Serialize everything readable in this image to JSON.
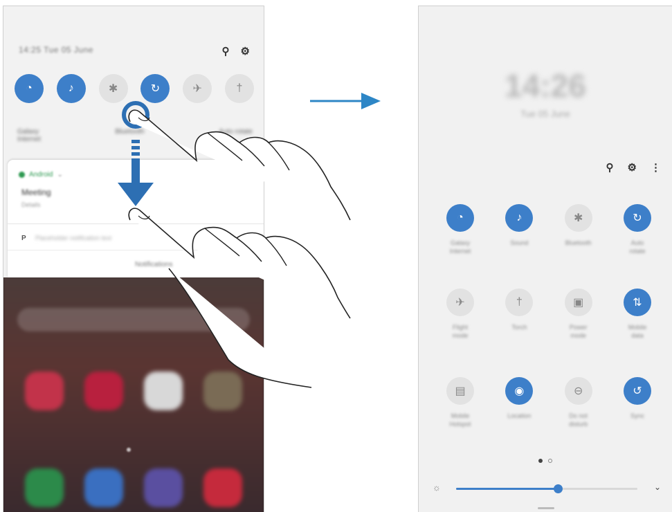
{
  "left_phone": {
    "status_text": "14:25 Tue 05 June",
    "toggles": [
      {
        "icon": "wifi-icon",
        "glyph": "◔",
        "on": true
      },
      {
        "icon": "sound-icon",
        "glyph": "♪",
        "on": true
      },
      {
        "icon": "bluetooth-icon",
        "glyph": "✱",
        "on": false
      },
      {
        "icon": "auto-rotate-icon",
        "glyph": "↻",
        "on": true
      },
      {
        "icon": "airplane-icon",
        "glyph": "✈",
        "on": false
      },
      {
        "icon": "flashlight-icon",
        "glyph": "†",
        "on": false
      }
    ],
    "sub_labels": [
      "Galaxy\nInternet",
      "Bluetooth",
      "Auto rotate"
    ],
    "notification": {
      "app_name": "Android",
      "title": "Meeting",
      "subtitle": "Details",
      "second_prefix": "P",
      "second_text": "Placeholder notification text",
      "clear_label": "Notifications"
    }
  },
  "right_phone": {
    "clock": "14:26",
    "date": "Tue 05 June",
    "tiles": [
      {
        "icon": "wifi-icon",
        "glyph": "◔",
        "on": true,
        "label": "Galaxy\nInternet"
      },
      {
        "icon": "sound-icon",
        "glyph": "♪",
        "on": true,
        "label": "Sound"
      },
      {
        "icon": "bluetooth-icon",
        "glyph": "✱",
        "on": false,
        "label": "Bluetooth"
      },
      {
        "icon": "auto-rotate-icon",
        "glyph": "↻",
        "on": true,
        "label": "Auto\nrotate"
      },
      {
        "icon": "airplane-icon",
        "glyph": "✈",
        "on": false,
        "label": "Flight\nmode"
      },
      {
        "icon": "flashlight-icon",
        "glyph": "†",
        "on": false,
        "label": "Torch"
      },
      {
        "icon": "power-mode-icon",
        "glyph": "▣",
        "on": false,
        "label": "Power\nmode"
      },
      {
        "icon": "mobile-data-icon",
        "glyph": "⇅",
        "on": true,
        "label": "Mobile\ndata"
      },
      {
        "icon": "hotspot-icon",
        "glyph": "▤",
        "on": false,
        "label": "Mobile\nHotspot"
      },
      {
        "icon": "location-icon",
        "glyph": "◉",
        "on": true,
        "label": "Location"
      },
      {
        "icon": "do-not-disturb-icon",
        "glyph": "⊖",
        "on": false,
        "label": "Do not\ndisturb"
      },
      {
        "icon": "sync-icon",
        "glyph": "↺",
        "on": true,
        "label": "Sync"
      }
    ],
    "brightness_level": 0.56
  },
  "colors": {
    "accent": "#3d7fc9",
    "arrow": "#2d86c6"
  }
}
